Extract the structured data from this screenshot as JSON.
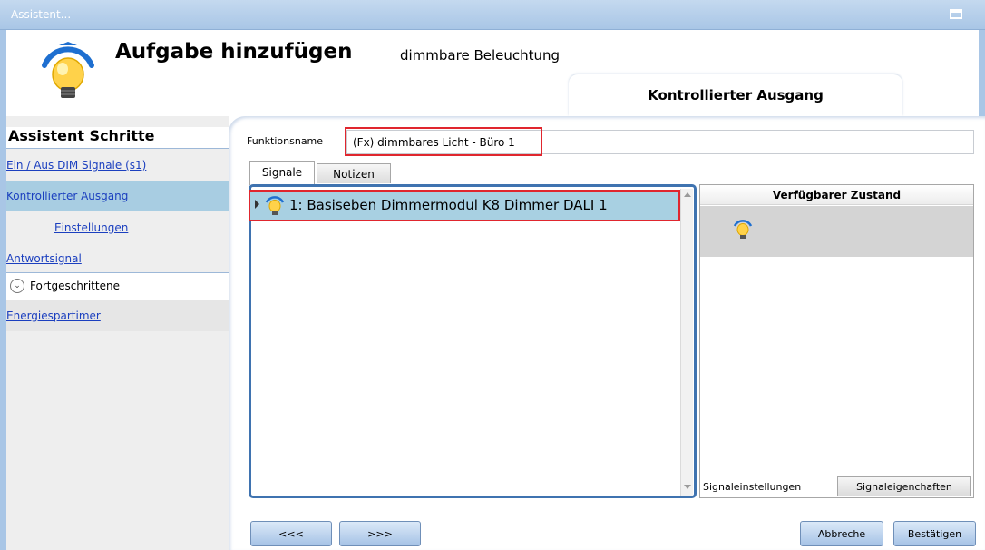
{
  "window": {
    "title": "Assistent..."
  },
  "header": {
    "title": "Aufgabe hinzufügen",
    "subtitle": "dimmbare Beleuchtung",
    "section_tab": "Kontrollierter Ausgang"
  },
  "sidebar": {
    "heading": "Assistent Schritte",
    "items": [
      {
        "label": "Ein / Aus DIM Signale (s1)"
      },
      {
        "label": "Kontrollierter Ausgang"
      },
      {
        "label": "Einstellungen"
      },
      {
        "label": "Antwortsignal"
      }
    ],
    "advanced_label": "Fortgeschrittene",
    "advanced_items": [
      {
        "label": "Energiespartimer"
      }
    ]
  },
  "form": {
    "function_name_label": "Funktionsname",
    "function_name_value": "(Fx) dimmbares Licht - Büro 1"
  },
  "tabs": [
    {
      "label": "Signale"
    },
    {
      "label": "Notizen"
    }
  ],
  "signals": [
    {
      "label": "1: Basiseben Dimmermodul K8 Dimmer DALI 1",
      "icon": "bulb-icon"
    }
  ],
  "state_panel": {
    "heading": "Verfügbarer Zustand",
    "icon": "bulb-icon",
    "tabs": [
      {
        "label": "Signaleinstellungen"
      },
      {
        "label": "Signaleigenchaften"
      }
    ]
  },
  "buttons": {
    "prev": "<<<",
    "next": ">>>",
    "cancel": "Abbreche",
    "confirm": "Bestätigen"
  },
  "colors": {
    "titlebar": "#a9c6e6",
    "selection": "#a8cde2",
    "highlight_mark": "#e0262e",
    "panel_border": "#3f73b0"
  }
}
